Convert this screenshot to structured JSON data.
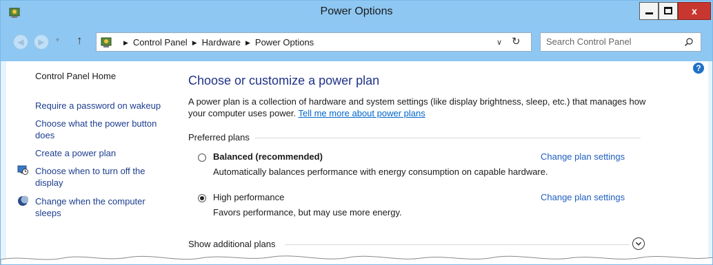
{
  "window": {
    "title": "Power Options"
  },
  "address": {
    "crumbs": [
      "Control Panel",
      "Hardware",
      "Power Options"
    ]
  },
  "search": {
    "placeholder": "Search Control Panel"
  },
  "sidebar": {
    "home": "Control Panel Home",
    "items": [
      {
        "label": "Require a password on wakeup",
        "icon": ""
      },
      {
        "label": "Choose what the power button does",
        "icon": ""
      },
      {
        "label": "Create a power plan",
        "icon": ""
      },
      {
        "label": "Choose when to turn off the display",
        "icon": "display-clock-icon"
      },
      {
        "label": "Change when the computer sleeps",
        "icon": "moon-icon"
      }
    ]
  },
  "main": {
    "heading": "Choose or customize a power plan",
    "description": "A power plan is a collection of hardware and system settings (like display brightness, sleep, etc.) that manages how your computer uses power.",
    "learn_more_link": "Tell me more about power plans",
    "preferred_label": "Preferred plans",
    "plans": [
      {
        "name": "Balanced (recommended)",
        "description": "Automatically balances performance with energy consumption on capable hardware.",
        "selected": false,
        "change_link": "Change plan settings"
      },
      {
        "name": "High performance",
        "description": "Favors performance, but may use more energy.",
        "selected": true,
        "change_link": "Change plan settings"
      }
    ],
    "additional_label": "Show additional plans"
  },
  "colors": {
    "titlebar": "#8ec7f2",
    "link": "#1e5ebe",
    "heading": "#1e3287",
    "close": "#c7372f"
  }
}
